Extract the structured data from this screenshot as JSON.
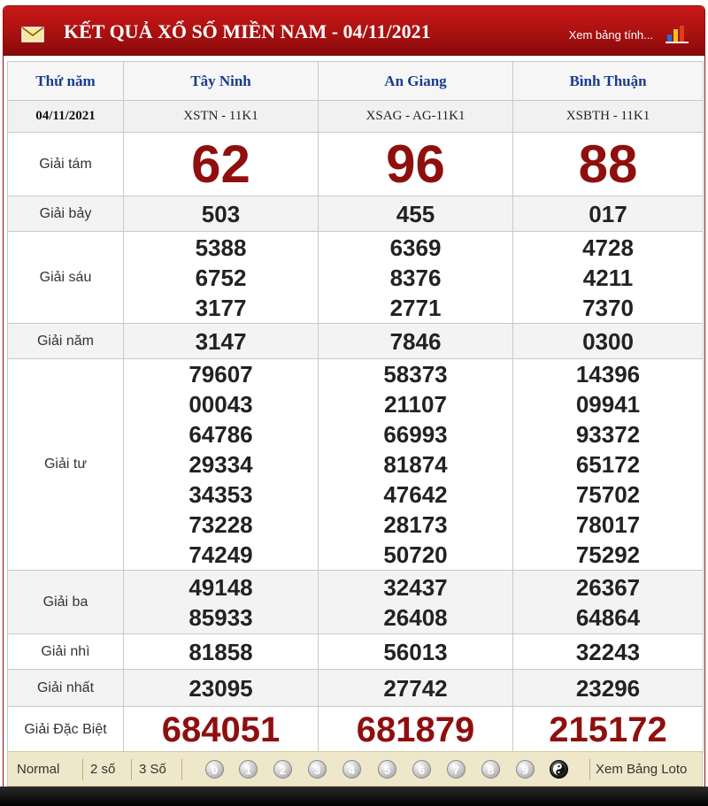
{
  "header": {
    "title": "KẾT QUẢ XỔ SỐ MIỀN NAM - 04/11/2021",
    "link_label": "Xem bảng tính...",
    "icons": [
      "mail-icon",
      "bar-chart-icon"
    ]
  },
  "table": {
    "day_label": "Thứ năm",
    "date": "04/11/2021",
    "provinces": [
      {
        "name": "Tây Ninh",
        "code": "XSTN - 11K1"
      },
      {
        "name": "An Giang",
        "code": "XSAG - AG-11K1"
      },
      {
        "name": "Bình Thuận",
        "code": "XSBTH - 11K1"
      }
    ],
    "prizes": {
      "g8": {
        "label": "Giải tám",
        "values": [
          "62",
          "96",
          "88"
        ]
      },
      "g7": {
        "label": "Giải bảy",
        "values": [
          "503",
          "455",
          "017"
        ]
      },
      "g6": {
        "label": "Giải sáu",
        "values": [
          [
            "5388",
            "6752",
            "3177"
          ],
          [
            "6369",
            "8376",
            "2771"
          ],
          [
            "4728",
            "4211",
            "7370"
          ]
        ]
      },
      "g5": {
        "label": "Giải năm",
        "values": [
          "3147",
          "7846",
          "0300"
        ]
      },
      "g4": {
        "label": "Giải tư",
        "values": [
          [
            "79607",
            "00043",
            "64786",
            "29334",
            "34353",
            "73228",
            "74249"
          ],
          [
            "58373",
            "21107",
            "66993",
            "81874",
            "47642",
            "28173",
            "50720"
          ],
          [
            "14396",
            "09941",
            "93372",
            "65172",
            "75702",
            "78017",
            "75292"
          ]
        ]
      },
      "g3": {
        "label": "Giải ba",
        "values": [
          [
            "49148",
            "85933"
          ],
          [
            "32437",
            "26408"
          ],
          [
            "26367",
            "64864"
          ]
        ]
      },
      "g2": {
        "label": "Giải nhì",
        "values": [
          "81858",
          "56013",
          "32243"
        ]
      },
      "g1": {
        "label": "Giải nhất",
        "values": [
          "23095",
          "27742",
          "23296"
        ]
      },
      "db": {
        "label": "Giải Đặc Biệt",
        "values": [
          "684051",
          "681879",
          "215172"
        ]
      }
    }
  },
  "footer": {
    "normal_label": "Normal",
    "two_digit_label": "2 số",
    "three_digit_label": "3 Số",
    "digits": [
      "0",
      "1",
      "2",
      "3",
      "4",
      "5",
      "6",
      "7",
      "8",
      "9"
    ],
    "loto_label": "Xem Bảng Loto"
  },
  "colors": {
    "header_red": "#b01212",
    "prize_red": "#8f0f0f",
    "province_blue": "#1a3c8f",
    "footer_bg": "#efe7c9"
  }
}
